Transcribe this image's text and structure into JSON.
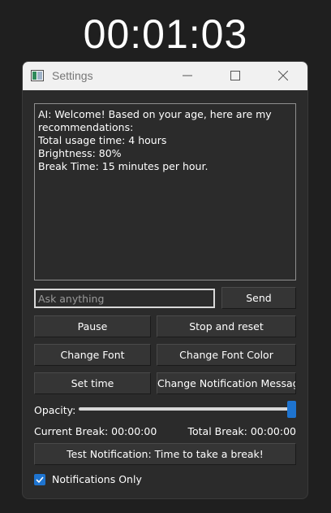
{
  "clock": {
    "time": "00:01:03"
  },
  "window": {
    "title": "Settings"
  },
  "ai_message": {
    "lines": [
      "AI: Welcome! Based on your age, here are my",
      "recommendations:",
      "Total usage time: 4 hours",
      "Brightness: 80%",
      "Break Time: 15 minutes per hour."
    ]
  },
  "ask": {
    "placeholder": "Ask anything",
    "value": ""
  },
  "buttons": {
    "send": "Send",
    "pause": "Pause",
    "stop_reset": "Stop and reset",
    "change_font": "Change Font",
    "change_font_color": "Change Font Color",
    "set_time": "Set time",
    "change_notification_message": "Change Notification Message",
    "test_notification": "Test Notification: Time to take a break!"
  },
  "opacity": {
    "label": "Opacity:",
    "value": 1.0
  },
  "breaks": {
    "current": "Current Break: 00:00:00",
    "total": "Total Break: 00:00:00"
  },
  "notifications_only": {
    "label": "Notifications Only",
    "checked": true
  },
  "colors": {
    "accent": "#1e74d0",
    "window_bg": "#2b2b2b",
    "titlebar_bg": "#f1f1f1"
  },
  "icons": {
    "app": "app-window-icon",
    "minimize": "minimize-icon",
    "maximize": "maximize-icon",
    "close": "close-icon",
    "check": "checkmark-icon"
  }
}
